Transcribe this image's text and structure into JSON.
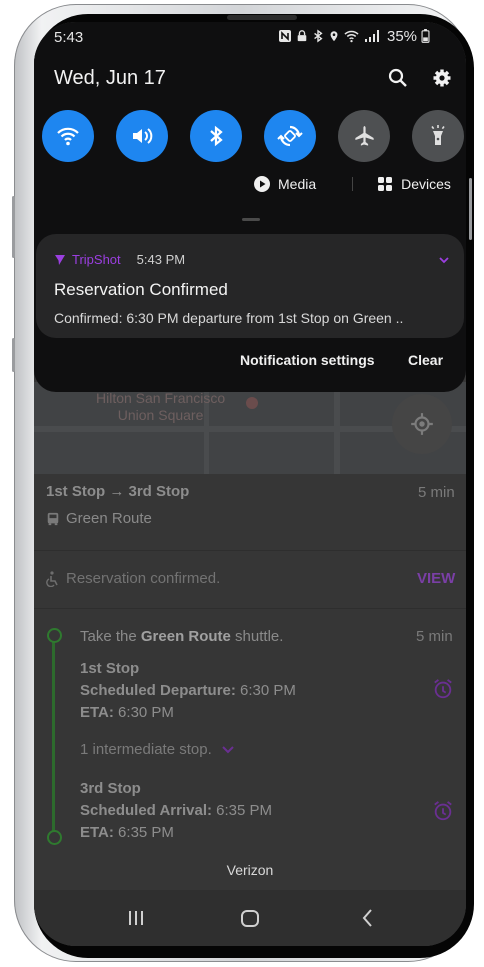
{
  "status_bar": {
    "time": "5:43",
    "battery": "35%"
  },
  "shade": {
    "date": "Wed, Jun 17",
    "quick_settings": [
      {
        "name": "wifi",
        "state": "on"
      },
      {
        "name": "sound",
        "state": "on"
      },
      {
        "name": "bluetooth",
        "state": "on"
      },
      {
        "name": "auto-rotate",
        "state": "on"
      },
      {
        "name": "airplane-mode",
        "state": "off"
      },
      {
        "name": "flashlight",
        "state": "off"
      }
    ],
    "media_label": "Media",
    "devices_label": "Devices"
  },
  "notification": {
    "app_name": "TripShot",
    "time": "5:43 PM",
    "title": "Reservation Confirmed",
    "body": "Confirmed:  6:30 PM departure from 1st Stop on Green ..",
    "settings_label": "Notification settings",
    "clear_label": "Clear"
  },
  "app": {
    "map_poi": "Hilton San Francisco\nUnion Square",
    "trip_title": "1st Stop → 3rd Stop",
    "trip_duration": "5 min",
    "route_name": "Green Route",
    "reservation_status": "Reservation confirmed.",
    "view_label": "VIEW",
    "step_prefix": "Take the ",
    "step_route": "Green Route",
    "step_suffix": " shuttle.",
    "step_duration": "5 min",
    "origin": {
      "name": "1st Stop",
      "departure_label": "Scheduled Departure:",
      "departure_time": " 6:30 PM",
      "eta_label": "ETA:",
      "eta_time": " 6:30 PM"
    },
    "intermediate": "1 intermediate stop.",
    "destination": {
      "name": "3rd Stop",
      "arrival_label": "Scheduled Arrival:",
      "arrival_time": " 6:35 PM",
      "eta_label": "ETA:",
      "eta_time": " 6:35 PM"
    },
    "carrier": "Verizon"
  },
  "colors": {
    "accent_blue": "#1e86f0",
    "tripshot_purple": "#9b3fe0",
    "route_green": "#2f7a2f"
  }
}
